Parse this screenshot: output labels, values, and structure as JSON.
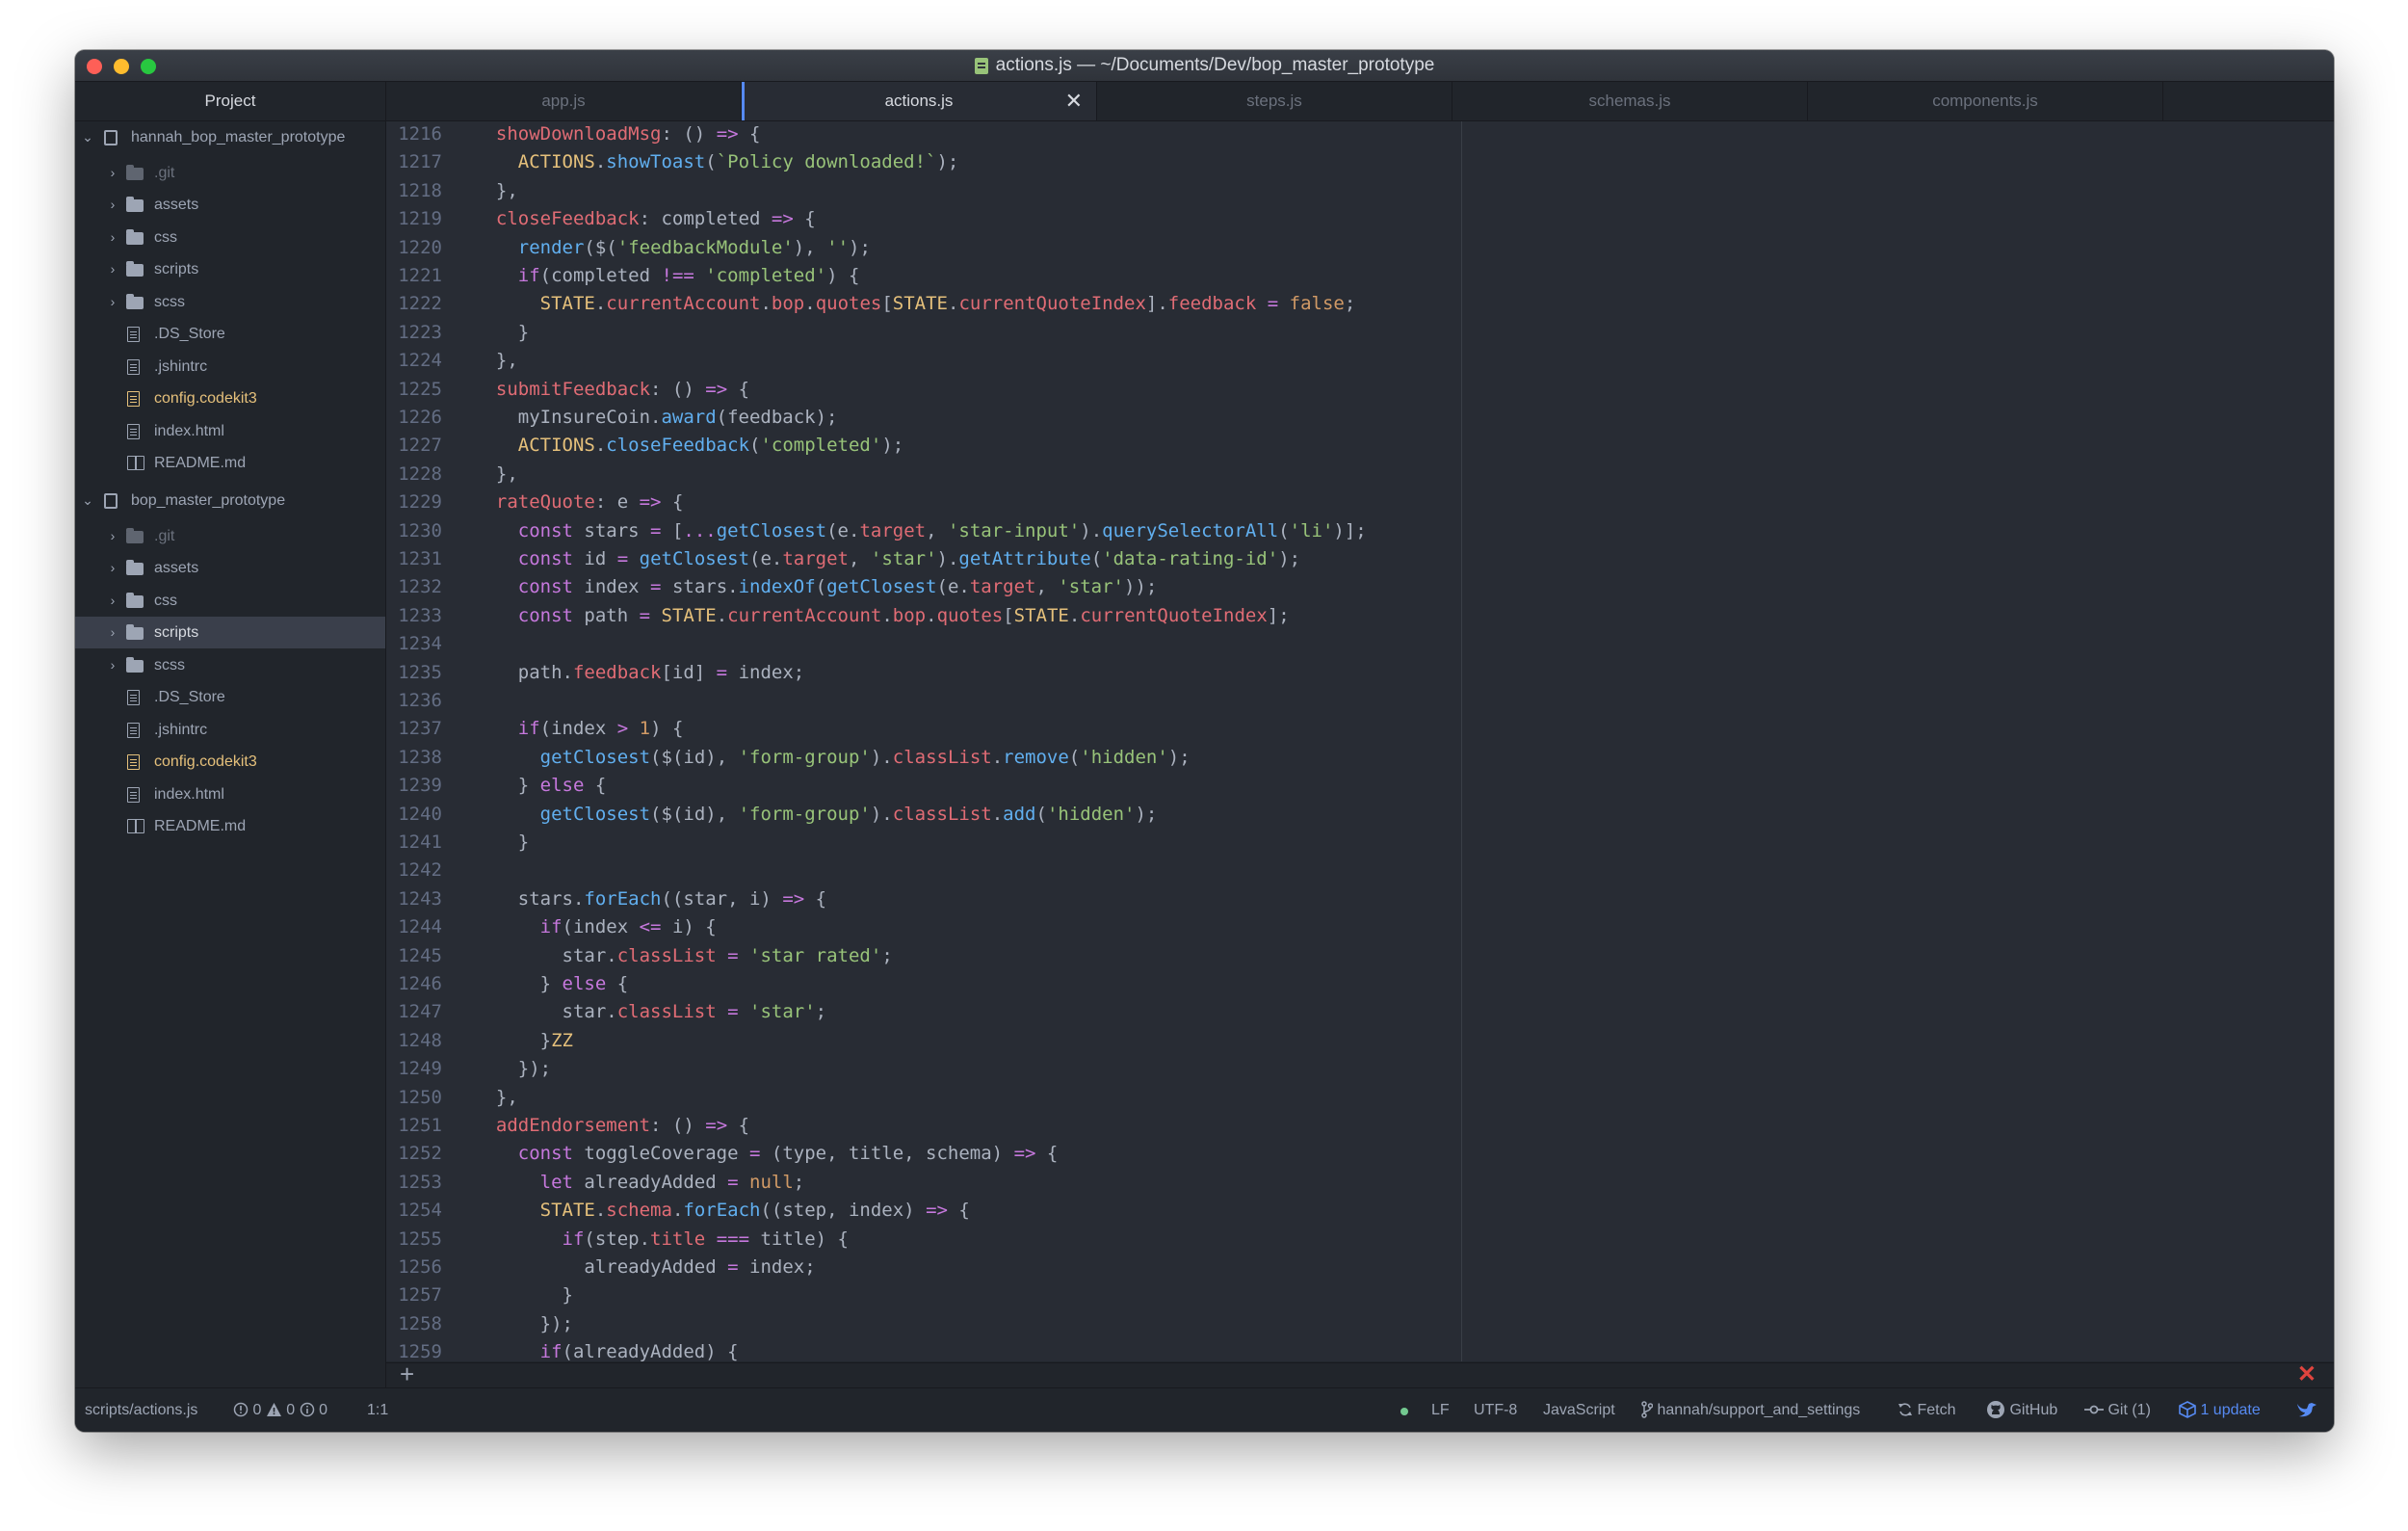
{
  "window": {
    "title": "actions.js — ~/Documents/Dev/bop_master_prototype"
  },
  "sidebar_header": "Project",
  "tabs": [
    {
      "label": "app.js",
      "active": false
    },
    {
      "label": "actions.js",
      "active": true
    },
    {
      "label": "steps.js",
      "active": false
    },
    {
      "label": "schemas.js",
      "active": false
    },
    {
      "label": "components.js",
      "active": false
    }
  ],
  "tab_close_glyph": "✕",
  "tree": [
    {
      "label": "hannah_bop_master_prototype",
      "kind": "repo",
      "expanded": true
    },
    {
      "label": ".git",
      "kind": "folder",
      "dim": true
    },
    {
      "label": "assets",
      "kind": "folder"
    },
    {
      "label": "css",
      "kind": "folder"
    },
    {
      "label": "scripts",
      "kind": "folder"
    },
    {
      "label": "scss",
      "kind": "folder"
    },
    {
      "label": ".DS_Store",
      "kind": "file"
    },
    {
      "label": ".jshintrc",
      "kind": "file"
    },
    {
      "label": "config.codekit3",
      "kind": "file",
      "modified": true
    },
    {
      "label": "index.html",
      "kind": "file"
    },
    {
      "label": "README.md",
      "kind": "book"
    },
    {
      "label": "bop_master_prototype",
      "kind": "repo",
      "expanded": true
    },
    {
      "label": ".git",
      "kind": "folder",
      "dim": true
    },
    {
      "label": "assets",
      "kind": "folder"
    },
    {
      "label": "css",
      "kind": "folder"
    },
    {
      "label": "scripts",
      "kind": "folder",
      "selected": true
    },
    {
      "label": "scss",
      "kind": "folder"
    },
    {
      "label": ".DS_Store",
      "kind": "file"
    },
    {
      "label": ".jshintrc",
      "kind": "file"
    },
    {
      "label": "config.codekit3",
      "kind": "file",
      "modified": true
    },
    {
      "label": "index.html",
      "kind": "file"
    },
    {
      "label": "README.md",
      "kind": "book"
    }
  ],
  "editor": {
    "first_line": 1216,
    "line_numbers": [
      "1216",
      "1217",
      "1218",
      "1219",
      "1220",
      "1221",
      "1222",
      "1223",
      "1224",
      "1225",
      "1226",
      "1227",
      "1228",
      "1229",
      "1230",
      "1231",
      "1232",
      "1233",
      "1234",
      "1235",
      "1236",
      "1237",
      "1238",
      "1239",
      "1240",
      "1241",
      "1242",
      "1243",
      "1244",
      "1245",
      "1246",
      "1247",
      "1248",
      "1249",
      "1250",
      "1251",
      "1252",
      "1253",
      "1254",
      "1255",
      "1256",
      "1257",
      "1258",
      "1259"
    ],
    "lines": [
      "  showDownloadMsg: () => {",
      "    ACTIONS.showToast(`Policy downloaded!`);",
      "  },",
      "  closeFeedback: completed => {",
      "    render($('feedbackModule'), '');",
      "    if(completed !== 'completed') {",
      "      STATE.currentAccount.bop.quotes[STATE.currentQuoteIndex].feedback = false;",
      "    }",
      "  },",
      "  submitFeedback: () => {",
      "    myInsureCoin.award(feedback);",
      "    ACTIONS.closeFeedback('completed');",
      "  },",
      "  rateQuote: e => {",
      "    const stars = [...getClosest(e.target, 'star-input').querySelectorAll('li')];",
      "    const id = getClosest(e.target, 'star').getAttribute('data-rating-id');",
      "    const index = stars.indexOf(getClosest(e.target, 'star'));",
      "    const path = STATE.currentAccount.bop.quotes[STATE.currentQuoteIndex];",
      "",
      "    path.feedback[id] = index;",
      "",
      "    if(index > 1) {",
      "      getClosest($(id), 'form-group').classList.remove('hidden');",
      "    } else {",
      "      getClosest($(id), 'form-group').classList.add('hidden');",
      "    }",
      "",
      "    stars.forEach((star, i) => {",
      "      if(index <= i) {",
      "        star.classList = 'star rated';",
      "      } else {",
      "        star.classList = 'star';",
      "      }ZZ",
      "    });",
      "  },",
      "  addEndorsement: () => {",
      "    const toggleCoverage = (type, title, schema) => {",
      "      let alreadyAdded = null;",
      "      STATE.schema.forEach((step, index) => {",
      "        if(step.title === title) {",
      "          alreadyAdded = index;",
      "        }",
      "      });",
      "      if(alreadyAdded) {"
    ]
  },
  "dock": {
    "add_glyph": "+",
    "close_glyph": "✕"
  },
  "status": {
    "file_path": "scripts/actions.js",
    "errors": "0",
    "warnings": "0",
    "infos": "0",
    "cursor": "1:1",
    "line_ending": "LF",
    "encoding": "UTF-8",
    "grammar": "JavaScript",
    "branch": "hannah/support_and_settings",
    "fetch": "Fetch",
    "github": "GitHub",
    "git": "Git (1)",
    "updates": "1 update"
  },
  "colors": {
    "keyword": "#c678dd",
    "function": "#61afef",
    "property": "#e06c75",
    "string": "#98c379",
    "number": "#d19a66",
    "constant": "#e5c07b",
    "accent": "#568af2"
  }
}
